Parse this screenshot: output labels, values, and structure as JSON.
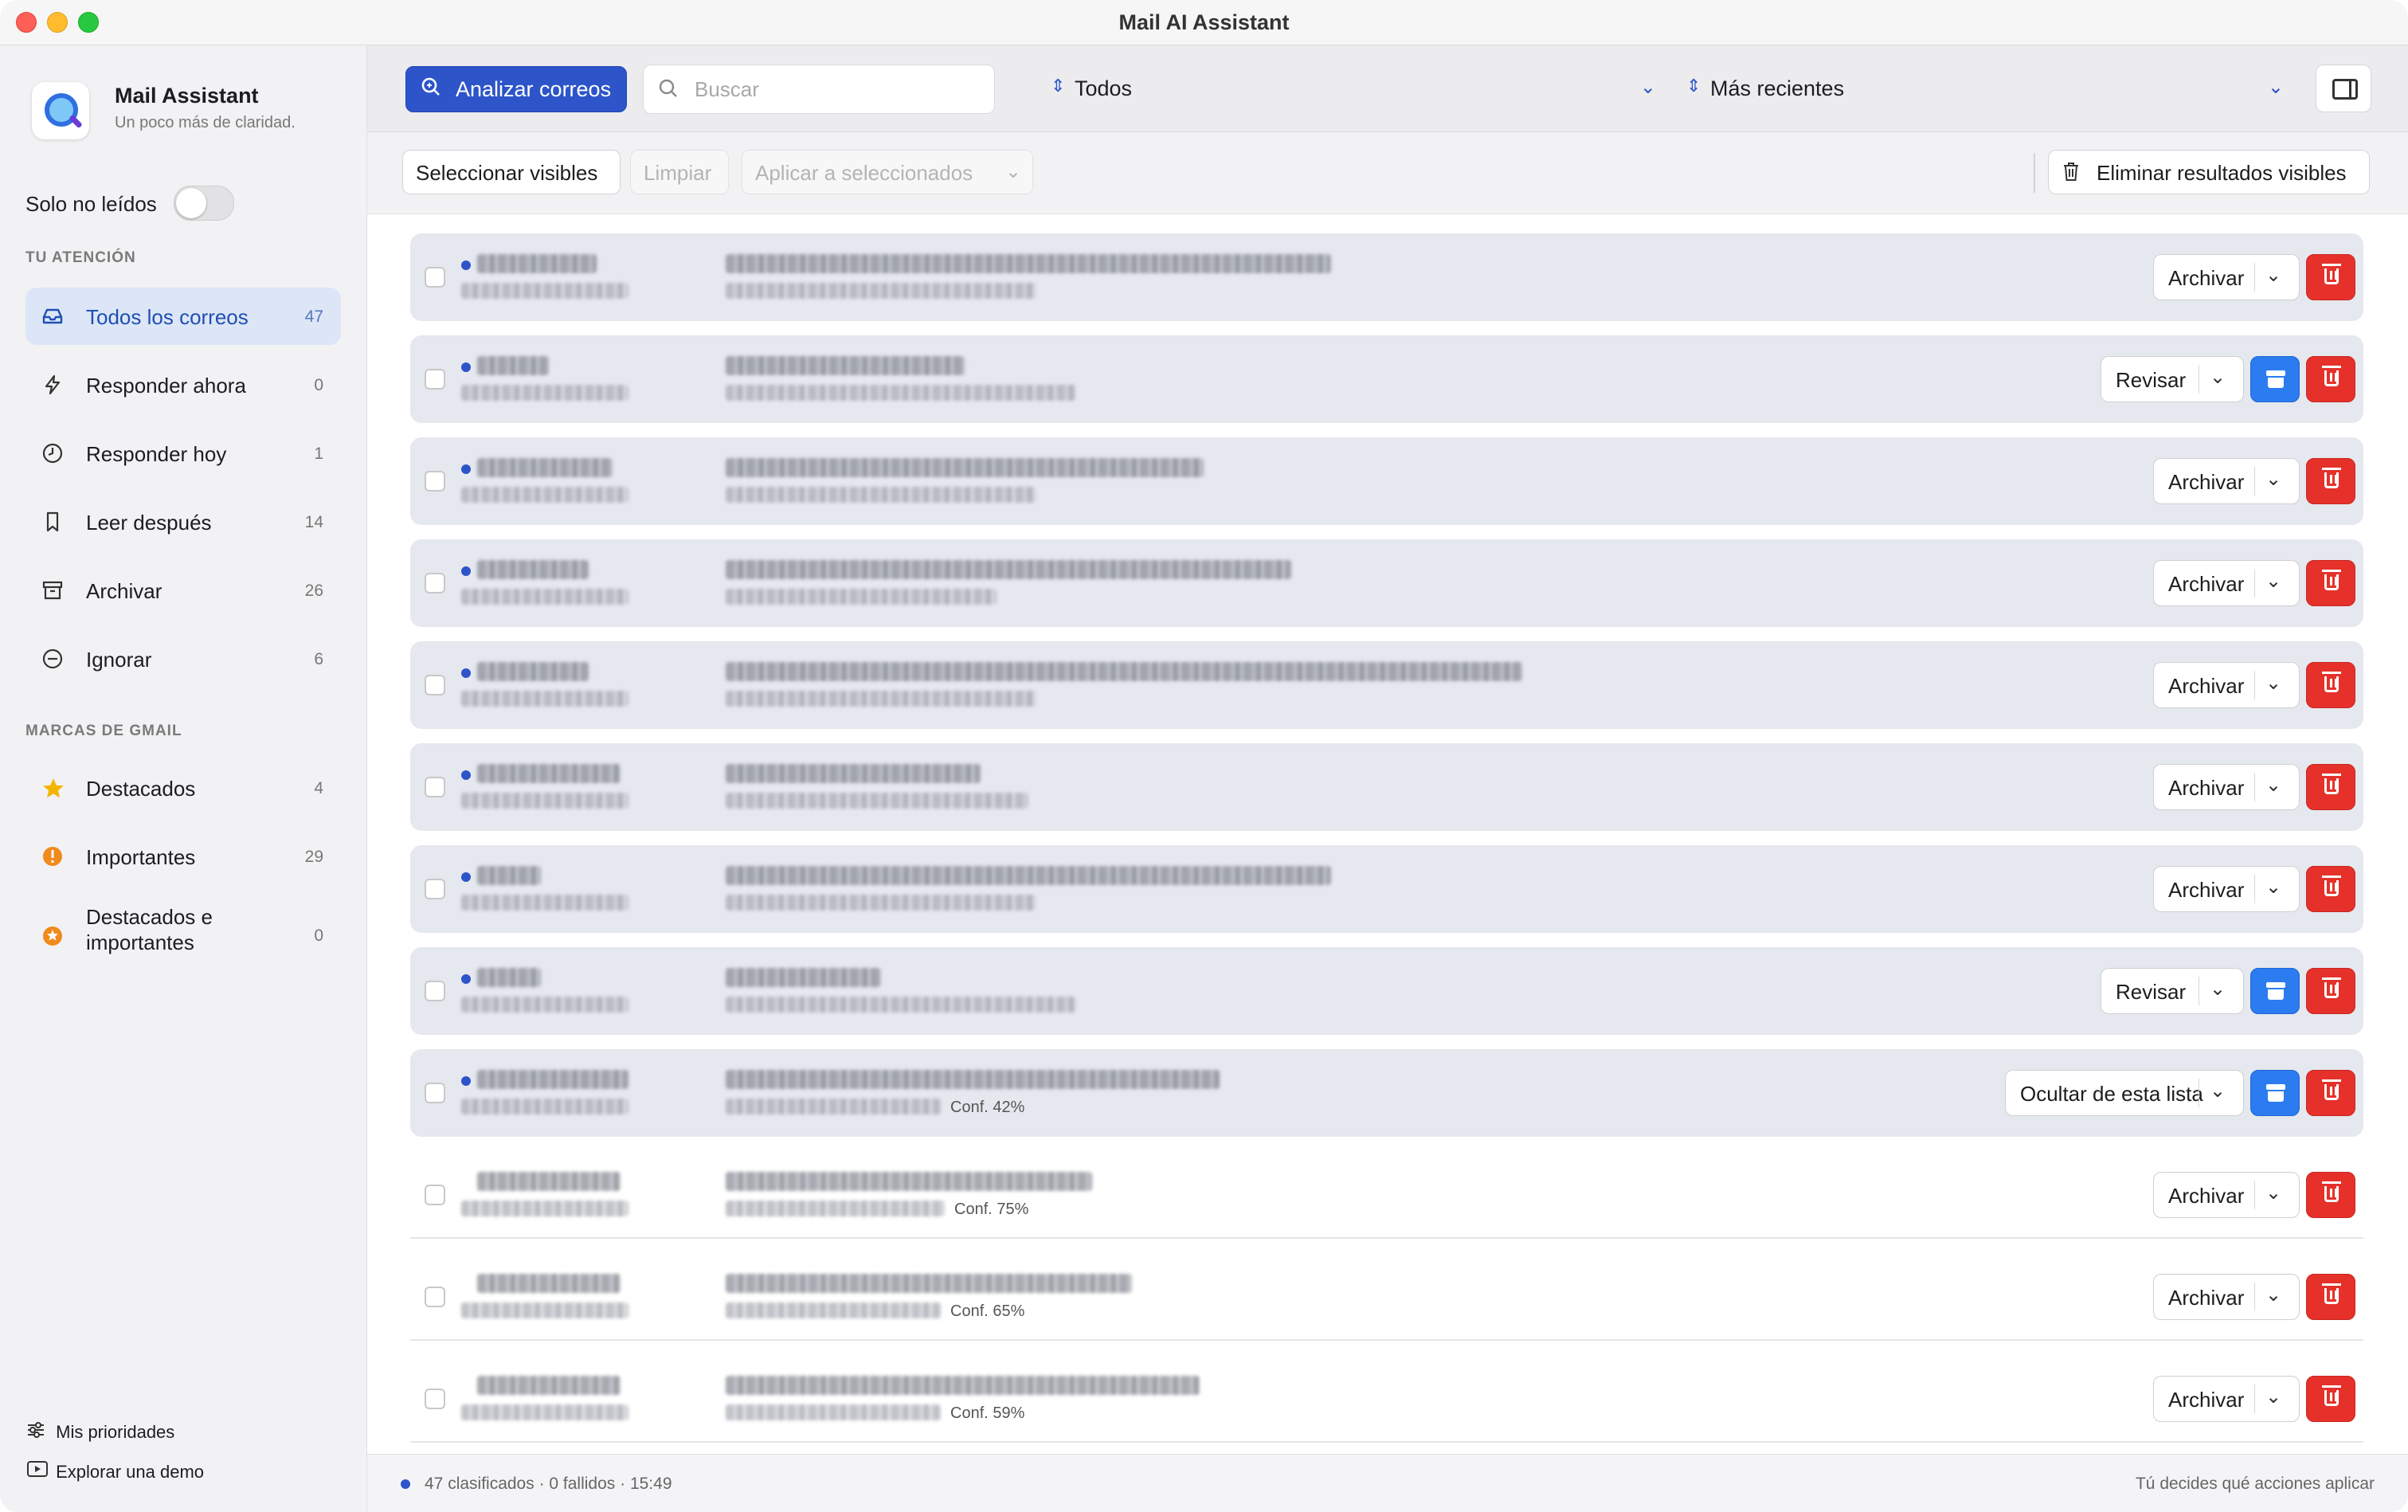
{
  "window": {
    "title": "Mail AI Assistant"
  },
  "app": {
    "name": "Mail Assistant",
    "tagline": "Un poco más de claridad."
  },
  "sidebar": {
    "unread_only_label": "Solo no leídos",
    "unread_only_on": false,
    "attention_header": "TU ATENCIÓN",
    "attention_items": [
      {
        "label": "Todos los correos",
        "count": "47",
        "icon": "inbox-icon",
        "active": true
      },
      {
        "label": "Responder ahora",
        "count": "0",
        "icon": "bolt-icon"
      },
      {
        "label": "Responder hoy",
        "count": "1",
        "icon": "clock-icon"
      },
      {
        "label": "Leer después",
        "count": "14",
        "icon": "bookmark-icon"
      },
      {
        "label": "Archivar",
        "count": "26",
        "icon": "archive-icon"
      },
      {
        "label": "Ignorar",
        "count": "6",
        "icon": "minus-circle-icon"
      }
    ],
    "gmail_header": "MARCAS DE GMAIL",
    "gmail_items": [
      {
        "label": "Destacados",
        "count": "4",
        "icon": "star-icon",
        "color": "#f5b400"
      },
      {
        "label": "Importantes",
        "count": "29",
        "icon": "important-icon",
        "color": "#f08a1c"
      },
      {
        "label": "Destacados e importantes",
        "count": "0",
        "icon": "starred-important-icon",
        "color": "#f08a1c"
      }
    ],
    "footer": {
      "priorities": "Mis prioridades",
      "demo": "Explorar una demo"
    }
  },
  "toolbar": {
    "analyze_label": "Analizar correos",
    "search_placeholder": "Buscar",
    "filter_value": "Todos",
    "sort_value": "Más recientes"
  },
  "actions": {
    "select_visible": "Seleccionar visibles",
    "clear": "Limpiar",
    "apply_selected": "Aplicar a seleccionados",
    "delete_visible": "Eliminar resultados visibles"
  },
  "emails": [
    {
      "unread": true,
      "action": "Archivar",
      "archive_button": false,
      "conf": ""
    },
    {
      "unread": true,
      "action": "Revisar",
      "archive_button": true,
      "conf": ""
    },
    {
      "unread": true,
      "action": "Archivar",
      "archive_button": false,
      "conf": ""
    },
    {
      "unread": true,
      "action": "Archivar",
      "archive_button": false,
      "conf": ""
    },
    {
      "unread": true,
      "action": "Archivar",
      "archive_button": false,
      "conf": ""
    },
    {
      "unread": true,
      "action": "Archivar",
      "archive_button": false,
      "conf": ""
    },
    {
      "unread": true,
      "action": "Archivar",
      "archive_button": false,
      "conf": ""
    },
    {
      "unread": true,
      "action": "Revisar",
      "archive_button": true,
      "conf": ""
    },
    {
      "unread": true,
      "action": "Ocultar de esta lista",
      "archive_button": true,
      "conf": "Conf. 42%"
    },
    {
      "unread": false,
      "action": "Archivar",
      "archive_button": false,
      "conf": "Conf. 75%"
    },
    {
      "unread": false,
      "action": "Archivar",
      "archive_button": false,
      "conf": "Conf. 65%"
    },
    {
      "unread": false,
      "action": "Archivar",
      "archive_button": false,
      "conf": "Conf. 59%"
    }
  ],
  "status": {
    "left": "47 clasificados · 0 fallidos · 15:49",
    "right": "Tú decides qué acciones aplicar"
  },
  "colors": {
    "accent": "#2d55c9",
    "delete": "#e5312a",
    "archive": "#2b7cf0"
  }
}
